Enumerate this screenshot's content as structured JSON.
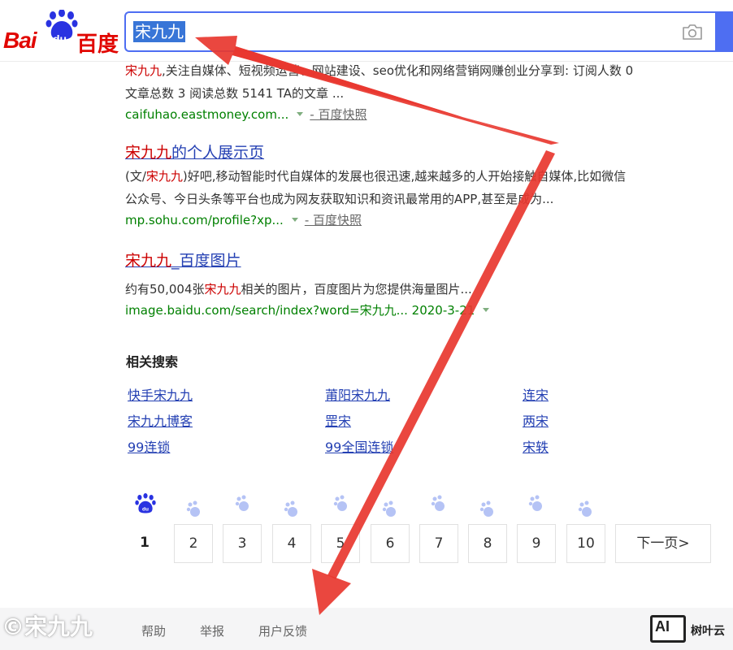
{
  "header": {
    "logo_bai": "Bai",
    "logo_du": "du",
    "logo_cn": "百度",
    "search_query": "宋九九"
  },
  "results": [
    {
      "abstract_line1": [
        "宋九九",
        ",关注自媒体、短视频运营、网站建设、seo优化和网络营销网赚创业分享到: 订阅人数 0"
      ],
      "abstract_line2": "文章总数 3 阅读总数 5141 TA的文章 ...",
      "source": "caifuhao.eastmoney.com...",
      "snapshot": "- 百度快照"
    },
    {
      "title_em": "宋九九",
      "title_rest": "的个人展示页",
      "abstract_line1": [
        "(文/",
        "宋九九",
        ")好吧,移动智能时代自媒体的发展也很迅速,越来越多的人开始接触自媒体,比如微信"
      ],
      "abstract_line2": "公众号、今日头条等平台也成为网友获取知识和资讯最常用的APP,甚至是成为...",
      "source": "mp.sohu.com/profile?xp...",
      "snapshot": "- 百度快照"
    },
    {
      "title_em": "宋九九",
      "title_rest": "_百度图片",
      "abstract_pre": "约有50,004张",
      "abstract_em": "宋九九",
      "abstract_post": "相关的图片，百度图片为您提供海量图片...",
      "source": "image.baidu.com/search/index?word=宋九九... 2020-3-21"
    }
  ],
  "related": {
    "heading": "相关搜索",
    "links": [
      "快手宋九九",
      "莆阳宋九九",
      "连宋",
      "宋九九博客",
      "罡宋",
      "两宋",
      "99连锁",
      "99全国连锁",
      "宋轶"
    ]
  },
  "pagination": {
    "pages": [
      "1",
      "2",
      "3",
      "4",
      "5",
      "6",
      "7",
      "8",
      "9",
      "10"
    ],
    "current": "1",
    "next": "下一页>"
  },
  "footer": {
    "watermark": "©宋九九",
    "links": [
      "帮助",
      "举报",
      "用户反馈"
    ],
    "brand_logo": "AI",
    "brand_name": "树叶云"
  },
  "colors": {
    "accent": "#4e6ef2",
    "link": "#2440b3",
    "highlight": "#c00000",
    "url_green": "#008000",
    "annotation_arrow": "#e8372f"
  },
  "icons": [
    "baidu-paw-icon",
    "camera-icon",
    "dropdown-triangle-icon",
    "pagination-paw-icon",
    "red-arrow-annotation"
  ]
}
